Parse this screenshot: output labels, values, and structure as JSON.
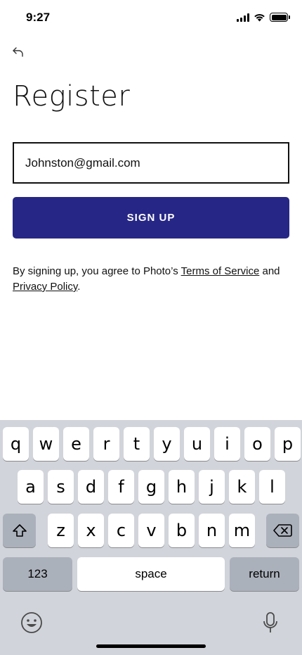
{
  "status_bar": {
    "time": "9:27"
  },
  "header": {
    "back_icon": "back-arrow-icon",
    "title": "Register"
  },
  "form": {
    "email_value": "Johnston@gmail.com",
    "signup_label": "SIGN UP"
  },
  "legal": {
    "prefix": "By signing up, you agree to Photo’s ",
    "terms_link": "Terms of Service",
    "middle": " and",
    "privacy_link": "Privacy Policy",
    "suffix": "."
  },
  "keyboard": {
    "row1": [
      "q",
      "w",
      "e",
      "r",
      "t",
      "y",
      "u",
      "i",
      "o",
      "p"
    ],
    "row2": [
      "a",
      "s",
      "d",
      "f",
      "g",
      "h",
      "j",
      "k",
      "l"
    ],
    "row3": [
      "z",
      "x",
      "c",
      "v",
      "b",
      "n",
      "m"
    ],
    "numbers_label": "123",
    "space_label": "space",
    "return_label": "return",
    "icons": [
      "shift-icon",
      "backspace-icon",
      "emoji-icon",
      "microphone-icon"
    ]
  },
  "colors": {
    "primary": "#262686",
    "keyboard_bg": "#d1d4da",
    "dark_key": "#abb1bb"
  }
}
